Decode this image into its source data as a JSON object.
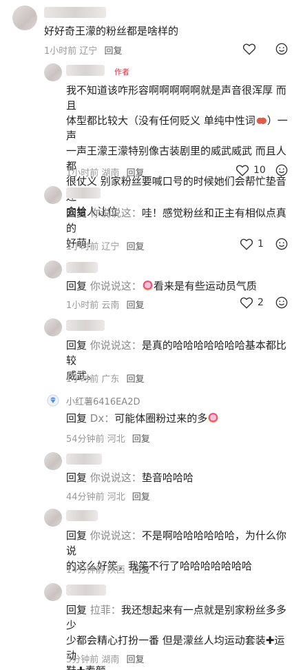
{
  "comments": [
    {
      "text": "好好奇王濛的粉丝都是啥样的",
      "time": "1小时前",
      "location": "辽宁",
      "reply_label": "回复",
      "likes": ""
    },
    {
      "author_tag": "作者",
      "text_lines": [
        "我不知道该咋形容啊啊啊啊啊就是声音很浑厚 而且",
        "体型都比较大（没有任何贬义 单纯中性词",
        "一声王濛王濛特别像古装剧里的威武威武 而且人都",
        "很仗义 别家粉丝要喊口号的时候她们会帮忙垫音 还",
        "会给人让位"
      ],
      "line2_tail": "）一声",
      "time": "1小时前",
      "location": "湖南",
      "reply_label": "回复",
      "likes": "10"
    },
    {
      "reply_kw": "回复",
      "reply_to": "你说说这：",
      "text_lines": [
        "哇！感觉粉丝和正主有相似点真的",
        "好萌！"
      ],
      "time": "1小时前",
      "location": "辽宁",
      "reply_label": "回复",
      "likes": "1"
    },
    {
      "reply_kw": "回复",
      "reply_to": "你说说这：",
      "text_lines": [
        "看来是有些运动员气质"
      ],
      "time": "1小时前",
      "location": "云南",
      "reply_label": "回复",
      "likes": "2"
    },
    {
      "reply_kw": "回复",
      "reply_to": "你说说这：",
      "text_lines": [
        "是真的哈哈哈哈哈哈哈基本都比较",
        "威武。"
      ],
      "time": "1小时前",
      "location": "广东",
      "reply_label": "回复",
      "likes": ""
    },
    {
      "username": "小红薯6416EA2D",
      "reply_kw": "回复",
      "reply_to": "Dx：",
      "text_lines": [
        "可能体圈粉过来的多"
      ],
      "time": "54分钟前",
      "location": "河北",
      "reply_label": "回复",
      "likes": ""
    },
    {
      "reply_kw": "回复",
      "reply_to": "你说说这：",
      "text_lines": [
        "垫音哈哈哈"
      ],
      "time": "44分钟前",
      "location": "河北",
      "reply_label": "回复",
      "likes": ""
    },
    {
      "reply_kw": "回复",
      "reply_to": "你说说这：",
      "text_lines": [
        "不是啊哈哈哈哈哈哈，为什么你说",
        "的这么好笑，我笑不行了哈哈哈哈哈哈哈"
      ],
      "time": "14分钟前",
      "location": "陕西",
      "reply_label": "回复",
      "likes": ""
    },
    {
      "reply_kw": "回复",
      "reply_to": "拉菲：",
      "text_lines": [
        "我还想起来有一点就是别家粉丝多多少",
        "少都会精心打扮一番 但是濛丝人均运动套装",
        "运动",
        "鞋",
        "素颜"
      ],
      "time": "5分钟前",
      "location": "湖南",
      "reply_label": "回复",
      "likes": ""
    }
  ],
  "colors": {
    "author_tag": "#e0364b",
    "meta": "#999999",
    "reply_to": "#888888"
  },
  "icons": {
    "like": "heart-outline-icon",
    "emoji": "smile-face-icon",
    "badge": "diamond-badge-icon"
  }
}
